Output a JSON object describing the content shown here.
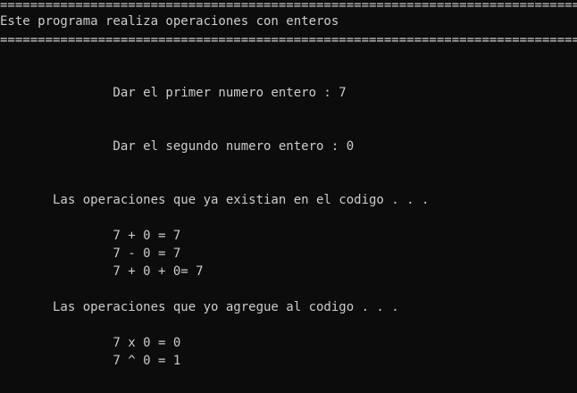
{
  "console": {
    "border_top": "=============================================================================",
    "title": "Este programa realiza operaciones con enteros",
    "border_bottom": "=============================================================================",
    "prompt_first": "               Dar el primer numero entero : 7",
    "prompt_second": "               Dar el segundo numero entero : 0",
    "existing_header": "       Las operaciones que ya existian en el codigo . . .",
    "existing_ops": [
      "               7 + 0 = 7",
      "               7 - 0 = 7",
      "               7 + 0 + 0= 7"
    ],
    "added_header": "       Las operaciones que yo agregue al codigo . . .",
    "added_ops": [
      "               7 x 0 = 0",
      "               7 ^ 0 = 1"
    ]
  }
}
